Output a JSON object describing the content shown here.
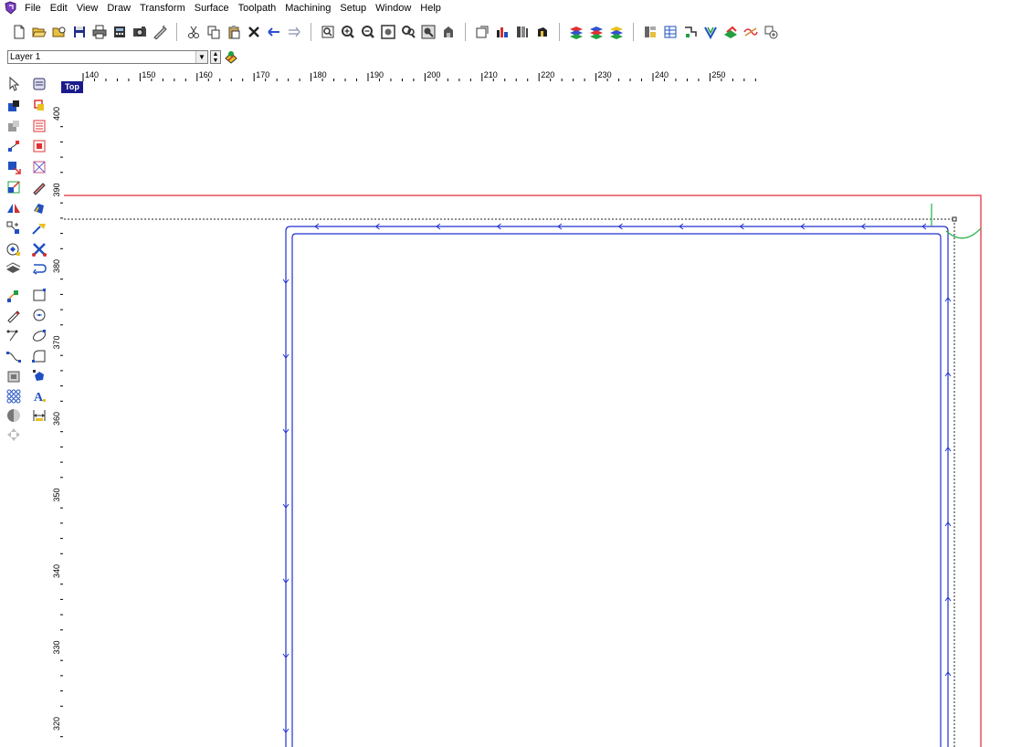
{
  "menubar": {
    "app_icon": "app-logo-icon",
    "items": [
      "File",
      "Edit",
      "View",
      "Draw",
      "Transform",
      "Surface",
      "Toolpath",
      "Machining",
      "Setup",
      "Window",
      "Help"
    ]
  },
  "layer": {
    "current": "Layer 1"
  },
  "viewport": {
    "view_name": "Top",
    "x_ruler_labels": [
      "140",
      "150",
      "160",
      "170",
      "180",
      "190",
      "200",
      "210",
      "220",
      "230",
      "240",
      "250"
    ],
    "y_ruler_labels": [
      "400",
      "390",
      "380",
      "370",
      "360",
      "350",
      "340",
      "330",
      "320"
    ]
  },
  "colors": {
    "stock_boundary": "#e8505a",
    "toolpath": "#2030d0",
    "lead_move": "#20b040",
    "badge": "#1a1a8c"
  }
}
